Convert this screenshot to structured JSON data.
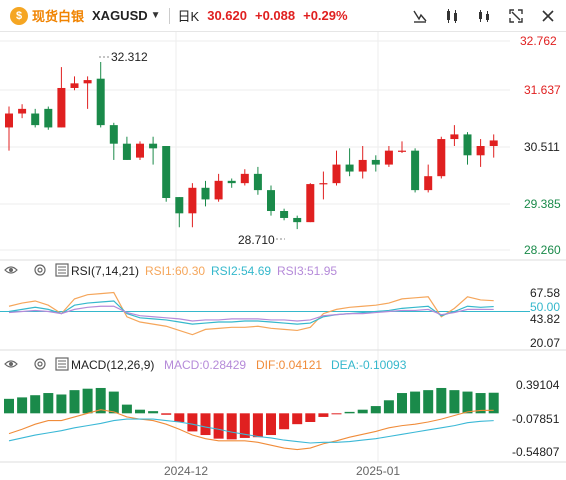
{
  "header": {
    "brand": "现货白银",
    "symbol": "XAGUSD",
    "period": "日K",
    "price": "30.620",
    "change": "+0.088",
    "change_pct": "+0.29%"
  },
  "icons": [
    "drag-icon",
    "compare-icon",
    "indicator-icon",
    "fullscreen-icon",
    "close-icon"
  ],
  "colors": {
    "up": "#e02020",
    "down": "#1a8a4a",
    "rsi1": "#f5a65b",
    "rsi2": "#35b8cc",
    "rsi3": "#b58ad9",
    "dif": "#f08c3a",
    "dea": "#3bb8d6",
    "hist_up": "#1a8a4a",
    "hist_down": "#e02020"
  },
  "chart_data": [
    {
      "type": "candlestick",
      "title": "XAGUSD 日K",
      "ylim": [
        28.26,
        32.762
      ],
      "y_ticks": [
        "32.762",
        "31.637",
        "30.511",
        "29.385",
        "28.260"
      ],
      "x_ticks": [
        "2024-12",
        "2025-01"
      ],
      "annotations": [
        {
          "label": "32.312",
          "value": 32.312,
          "bar": 7
        },
        {
          "label": "28.710",
          "value": 28.71,
          "bar": 22
        }
      ],
      "candles": [
        [
          30.9,
          31.2,
          30.4,
          31.35
        ],
        [
          31.2,
          31.3,
          31.1,
          31.4
        ],
        [
          31.2,
          30.95,
          30.9,
          31.3
        ],
        [
          31.3,
          30.9,
          30.85,
          31.35
        ],
        [
          30.9,
          31.75,
          30.9,
          32.2
        ],
        [
          31.75,
          31.85,
          31.7,
          32.0
        ],
        [
          31.85,
          31.92,
          31.3,
          32.0
        ],
        [
          31.95,
          30.95,
          30.9,
          32.31
        ],
        [
          30.95,
          30.55,
          30.2,
          31.0
        ],
        [
          30.55,
          30.2,
          30.2,
          30.7
        ],
        [
          30.25,
          30.55,
          30.2,
          30.6
        ],
        [
          30.55,
          30.45,
          30.1,
          30.7
        ],
        [
          30.5,
          29.38,
          29.3,
          30.5
        ],
        [
          29.4,
          29.05,
          28.75,
          29.4
        ],
        [
          29.05,
          29.6,
          28.75,
          29.7
        ],
        [
          29.6,
          29.35,
          29.2,
          29.75
        ],
        [
          29.35,
          29.75,
          29.3,
          29.9
        ],
        [
          29.75,
          29.7,
          29.6,
          29.8
        ],
        [
          29.7,
          29.9,
          29.65,
          30.0
        ],
        [
          29.9,
          29.55,
          29.45,
          30.05
        ],
        [
          29.55,
          29.1,
          29.0,
          29.65
        ],
        [
          29.1,
          28.95,
          28.9,
          29.15
        ],
        [
          28.95,
          28.86,
          28.71,
          29.0
        ],
        [
          28.86,
          29.68,
          28.86,
          29.7
        ],
        [
          29.68,
          29.7,
          29.35,
          29.95
        ],
        [
          29.7,
          30.1,
          29.65,
          30.4
        ],
        [
          30.1,
          29.95,
          29.85,
          30.45
        ],
        [
          29.95,
          30.2,
          29.8,
          30.5
        ],
        [
          30.2,
          30.1,
          29.95,
          30.3
        ],
        [
          30.1,
          30.4,
          30.05,
          30.5
        ],
        [
          30.4,
          30.4,
          30.35,
          30.6
        ],
        [
          30.4,
          29.55,
          29.5,
          30.45
        ],
        [
          29.55,
          29.85,
          29.5,
          30.1
        ],
        [
          29.85,
          30.65,
          29.8,
          30.7
        ],
        [
          30.65,
          30.75,
          30.5,
          30.95
        ],
        [
          30.75,
          30.3,
          30.1,
          30.8
        ],
        [
          30.3,
          30.5,
          30.05,
          30.65
        ],
        [
          30.5,
          30.62,
          30.25,
          30.75
        ]
      ]
    },
    {
      "type": "line",
      "title": "RSI(7,14,21)",
      "ylim": [
        20.07,
        67.58
      ],
      "y_ticks": [
        "67.58",
        "50.00",
        "43.82",
        "20.07"
      ],
      "reference_line": 50.0,
      "series": [
        {
          "name": "RSI1:60.30",
          "values": [
            55,
            58,
            60,
            56,
            48,
            62,
            66,
            67,
            68,
            45,
            40,
            38,
            36,
            32,
            28,
            33,
            34,
            35,
            35,
            36,
            34,
            33,
            32,
            35,
            48,
            52,
            54,
            55,
            56,
            58,
            62,
            63,
            64,
            45,
            53,
            64,
            61,
            60.3
          ]
        },
        {
          "name": "RSI2:54.69",
          "values": [
            50,
            52,
            54,
            52,
            48,
            56,
            58,
            59,
            60,
            48,
            44,
            43,
            42,
            40,
            38,
            39,
            40,
            40,
            41,
            41,
            40,
            39,
            38,
            39,
            45,
            47,
            48,
            49,
            50,
            51,
            53,
            54,
            55,
            46,
            50,
            55,
            54,
            54.69
          ]
        },
        {
          "name": "RSI3:51.95",
          "values": [
            49,
            50,
            51,
            50,
            48,
            52,
            54,
            55,
            55,
            49,
            46,
            45,
            44,
            43,
            41,
            42,
            42,
            43,
            43,
            43,
            42,
            42,
            41,
            42,
            46,
            47,
            48,
            48,
            49,
            50,
            51,
            51,
            52,
            47,
            49,
            52,
            52,
            51.95
          ]
        }
      ]
    },
    {
      "type": "bar+line",
      "title": "MACD(12,26,9)",
      "ylim": [
        -0.54807,
        0.39104
      ],
      "y_ticks": [
        "0.39104",
        "-0.07851",
        "-0.54807"
      ],
      "x_ticks": [
        "2024-12",
        "2025-01"
      ],
      "series": [
        {
          "name": "MACD:0.28429",
          "values": [
            0.2,
            0.22,
            0.25,
            0.28,
            0.26,
            0.32,
            0.34,
            0.35,
            0.3,
            0.12,
            0.05,
            0.03,
            -0.02,
            -0.12,
            -0.25,
            -0.3,
            -0.35,
            -0.36,
            -0.34,
            -0.33,
            -0.3,
            -0.22,
            -0.15,
            -0.12,
            -0.05,
            -0.01,
            0.02,
            0.05,
            0.1,
            0.18,
            0.28,
            0.3,
            0.32,
            0.35,
            0.32,
            0.3,
            0.28,
            0.28429
          ]
        },
        {
          "name": "DIF:0.04121",
          "values": [
            -0.28,
            -0.22,
            -0.15,
            -0.1,
            -0.1,
            -0.05,
            0.0,
            0.05,
            0.02,
            -0.05,
            -0.08,
            -0.1,
            -0.15,
            -0.22,
            -0.3,
            -0.35,
            -0.38,
            -0.38,
            -0.38,
            -0.4,
            -0.44,
            -0.48,
            -0.5,
            -0.48,
            -0.42,
            -0.38,
            -0.33,
            -0.29,
            -0.25,
            -0.2,
            -0.17,
            -0.15,
            -0.12,
            -0.08,
            -0.03,
            0.02,
            0.04,
            0.04121
          ]
        },
        {
          "name": "DEA:-0.10093",
          "values": [
            -0.38,
            -0.34,
            -0.3,
            -0.27,
            -0.24,
            -0.2,
            -0.17,
            -0.14,
            -0.1,
            -0.08,
            -0.08,
            -0.08,
            -0.1,
            -0.12,
            -0.15,
            -0.19,
            -0.22,
            -0.26,
            -0.29,
            -0.32,
            -0.34,
            -0.37,
            -0.39,
            -0.41,
            -0.4,
            -0.4,
            -0.39,
            -0.37,
            -0.35,
            -0.32,
            -0.29,
            -0.26,
            -0.23,
            -0.2,
            -0.17,
            -0.13,
            -0.11,
            -0.10093
          ]
        }
      ]
    }
  ]
}
